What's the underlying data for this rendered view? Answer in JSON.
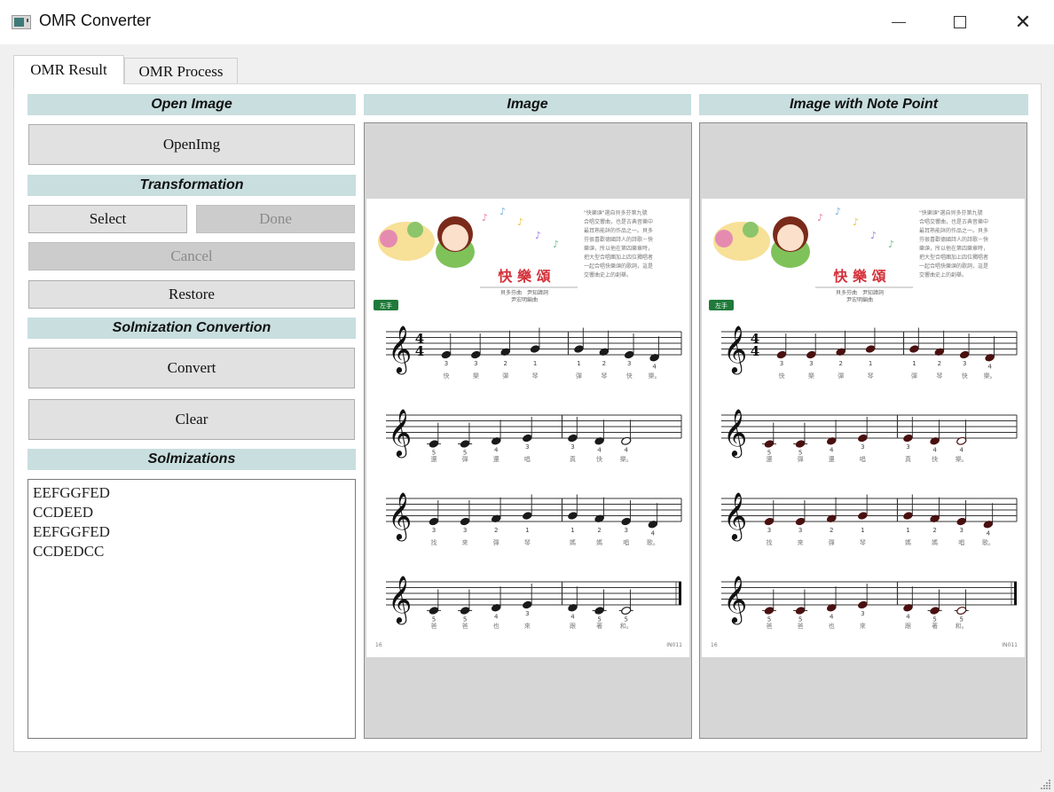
{
  "window": {
    "title": "OMR Converter",
    "icon": "app-window-icon",
    "controls": {
      "minimize": "minimize-icon",
      "maximize": "maximize-icon",
      "close": "close-icon",
      "close_glyph": "✕"
    }
  },
  "tabs": [
    {
      "label": "OMR Result",
      "active": true
    },
    {
      "label": "OMR Process",
      "active": false
    }
  ],
  "left_panel": {
    "open_image": {
      "header": "Open Image",
      "open_button": "OpenImg"
    },
    "transformation": {
      "header": "Transformation",
      "select_button": "Select",
      "done_button": "Done",
      "cancel_button": "Cancel",
      "restore_button": "Restore"
    },
    "solmization_convertion": {
      "header": "Solmization Convertion",
      "convert_button": "Convert",
      "clear_button": "Clear"
    },
    "solmizations": {
      "header": "Solmizations",
      "lines": [
        "EEFGGFED",
        "CCDEED",
        "EEFGGFED",
        "CCDEDCC"
      ]
    }
  },
  "image_panel": {
    "header": "Image"
  },
  "note_point_panel": {
    "header": "Image with Note Point"
  },
  "sheet_music": {
    "title": "快 樂 頌",
    "credits": [
      "貝多芬曲　尹知諱詞",
      "尹宏明編曲"
    ],
    "hand_badge": "左手",
    "description": [
      "\"快樂頌\"選自貝多芬第九號",
      "合唱交響曲，也是古典音樂中",
      "最耳熟能詳的作品之一。貝多",
      "芬很喜歡德國詩人的詩歌－快",
      "樂頌，所以他在第四樂章時，",
      "把大型合唱團加上四位獨唱者",
      "一起合唱快樂頌的歌詞，這是",
      "交響曲史上的創舉。"
    ],
    "page_number": "16",
    "code": "IN011",
    "time_signature": "4/4",
    "staves": [
      {
        "notes": [
          "E",
          "E",
          "F",
          "G",
          "G",
          "F",
          "E",
          "D"
        ],
        "fingers": [
          "3",
          "3",
          "2",
          "1",
          "1",
          "2",
          "3",
          "4"
        ],
        "lyrics": [
          "快",
          "樂",
          "彈",
          "琴",
          "彈",
          "琴",
          "快",
          "樂。"
        ],
        "last_half": false,
        "final": false
      },
      {
        "notes": [
          "C",
          "C",
          "D",
          "E",
          "E",
          "D",
          "D"
        ],
        "fingers": [
          "5",
          "5",
          "4",
          "3",
          "3",
          "4",
          "4"
        ],
        "lyrics": [
          "還",
          "彈",
          "還",
          "唱",
          "真",
          "快",
          "樂。"
        ],
        "last_half": true,
        "final": false
      },
      {
        "notes": [
          "E",
          "E",
          "F",
          "G",
          "G",
          "F",
          "E",
          "D"
        ],
        "fingers": [
          "3",
          "3",
          "2",
          "1",
          "1",
          "2",
          "3",
          "4"
        ],
        "lyrics": [
          "找",
          "來",
          "彈",
          "琴",
          "媽",
          "媽",
          "唱",
          "歌。"
        ],
        "last_half": false,
        "final": false
      },
      {
        "notes": [
          "C",
          "C",
          "D",
          "E",
          "D",
          "C",
          "C"
        ],
        "fingers": [
          "5",
          "5",
          "4",
          "3",
          "4",
          "5",
          "5"
        ],
        "lyrics": [
          "爸",
          "爸",
          "也",
          "來",
          "跟",
          "著",
          "和。"
        ],
        "last_half": true,
        "final": true
      }
    ],
    "note_color_plain": "#1a1a1a",
    "note_color_marked": "#4a1010"
  },
  "colors": {
    "section_header_bg": "#c8dedf",
    "button_bg": "#e1e1e1",
    "button_disabled_bg": "#cccccc",
    "disabled_text": "#8a8a8a",
    "view_bg": "#d6d6d6",
    "title_red": "#d4303a",
    "badge_green": "#1f7a3a"
  }
}
